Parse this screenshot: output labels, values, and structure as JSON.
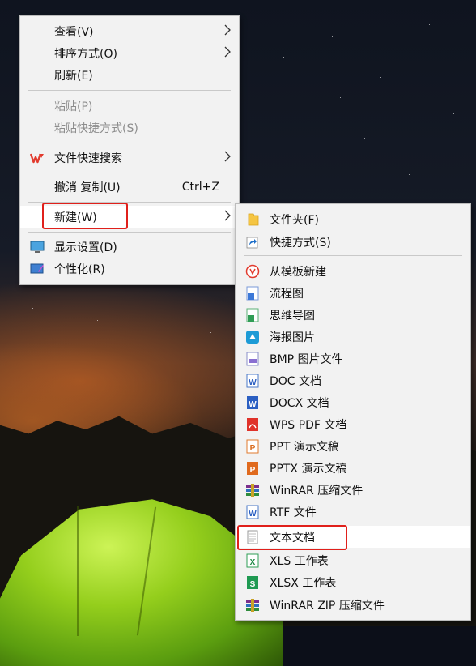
{
  "main_menu": {
    "view": "查看(V)",
    "sort": "排序方式(O)",
    "refresh": "刷新(E)",
    "paste": "粘贴(P)",
    "paste_shortcut": "粘贴快捷方式(S)",
    "quick_search": "文件快速搜索",
    "undo_copy": "撤消 复制(U)",
    "undo_accel": "Ctrl+Z",
    "new": "新建(W)",
    "display_settings": "显示设置(D)",
    "personalize": "个性化(R)"
  },
  "new_submenu": {
    "folder": "文件夹(F)",
    "shortcut": "快捷方式(S)",
    "from_template": "从模板新建",
    "flowchart": "流程图",
    "mindmap": "思维导图",
    "poster": "海报图片",
    "bmp": "BMP 图片文件",
    "doc": "DOC 文档",
    "docx": "DOCX 文档",
    "wps_pdf": "WPS PDF 文档",
    "ppt": "PPT 演示文稿",
    "pptx": "PPTX 演示文稿",
    "winrar": "WinRAR 压缩文件",
    "rtf": "RTF 文件",
    "txt": "文本文档",
    "xls": "XLS 工作表",
    "xlsx": "XLSX 工作表",
    "winrar_zip": "WinRAR ZIP 压缩文件"
  },
  "colors": {
    "highlight_border": "#e0201b",
    "menu_bg": "#f2f2f2",
    "disabled_text": "#8d8d8d"
  }
}
